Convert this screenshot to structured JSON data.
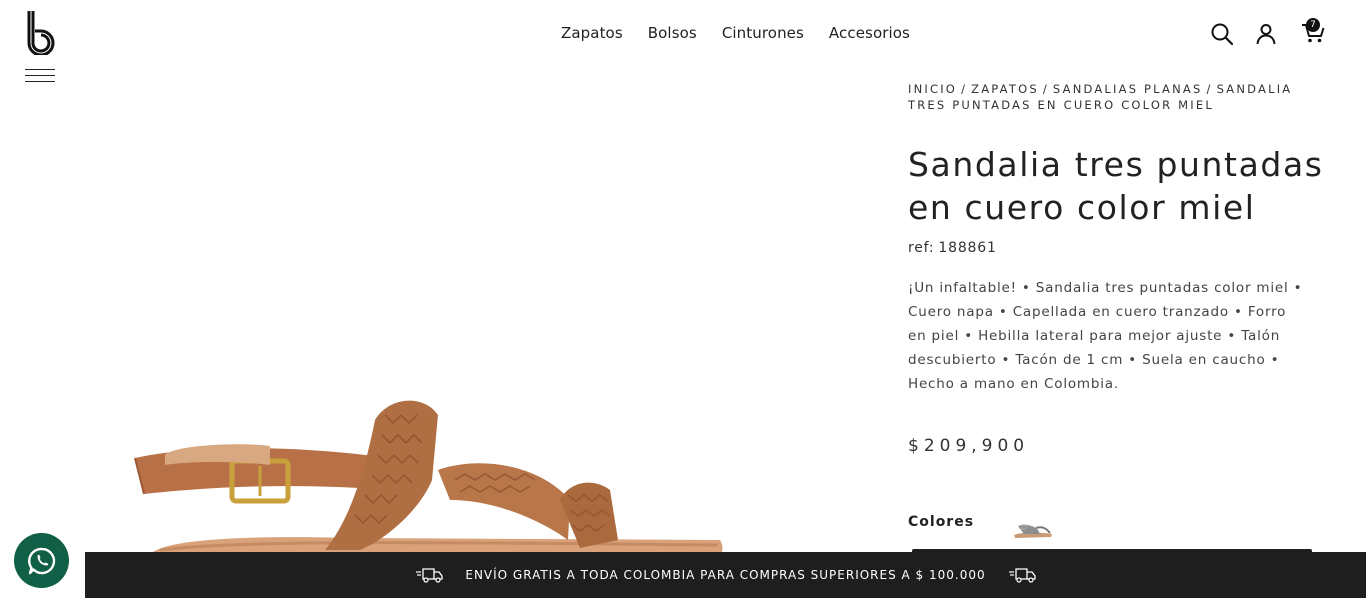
{
  "header": {
    "nav": [
      "Zapatos",
      "Bolsos",
      "Cinturones",
      "Accesorios"
    ],
    "cart_count": "7"
  },
  "breadcrumb": [
    "INICIO",
    "ZAPATOS",
    "SANDALIAS PLANAS",
    "SANDALIA TRES PUNTADAS EN CUERO COLOR MIEL"
  ],
  "product": {
    "title": "Sandalia tres puntadas en cuero color miel",
    "ref_label": "ref:",
    "ref_value": "188861",
    "description": "¡Un infaltable! • Sandalia tres puntadas color miel • Cuero napa • Capellada en cuero tranzado • Forro en piel • Hebilla lateral para mejor ajuste • Talón descubierto • Tacón de 1 cm • Suela en caucho • Hecho a mano en Colombia.",
    "price": "$209,900",
    "colors_label": "Colores"
  },
  "promo": {
    "text": "ENVÍO GRATIS A TODA COLOMBIA PARA COMPRAS SUPERIORES A $ 100.000"
  },
  "icons": [
    "logo-b",
    "menu-icon",
    "search-icon",
    "user-icon",
    "cart-icon",
    "truck-icon",
    "whatsapp-icon"
  ],
  "colors": {
    "promo_bg": "#1e1e1e",
    "whatsapp_bg": "#105f46",
    "sandal_leather": "#b97a4f"
  }
}
